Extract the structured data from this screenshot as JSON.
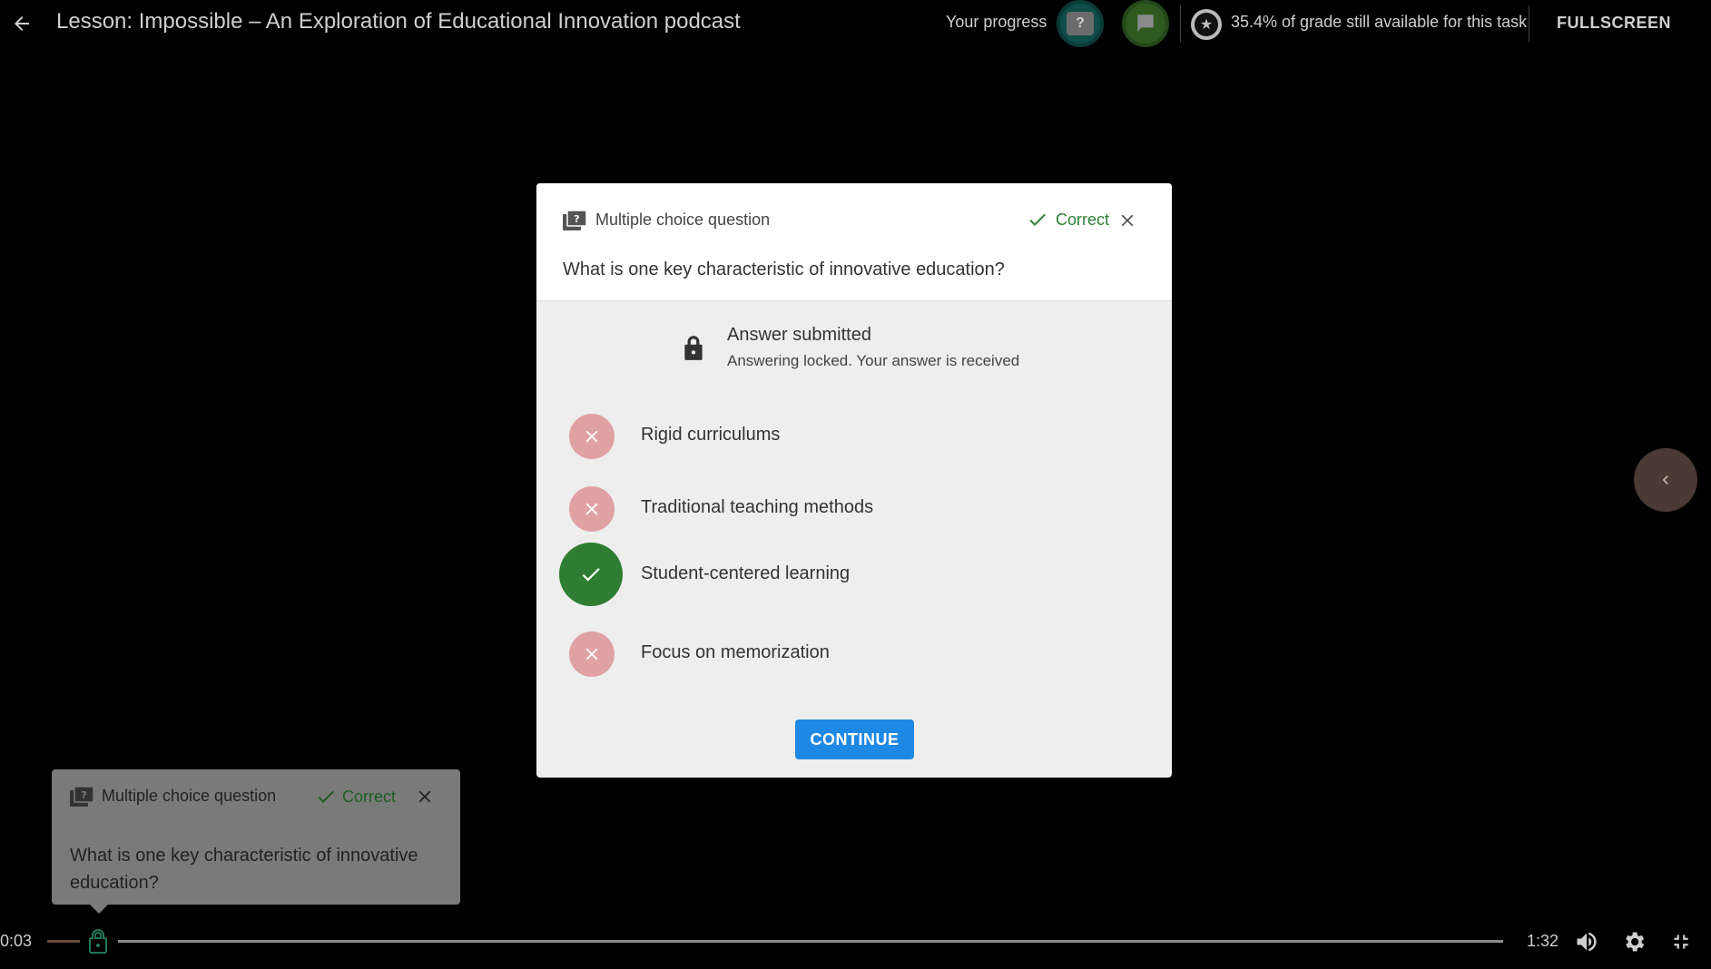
{
  "header": {
    "title": "Lesson: Impossible – An Exploration of Educational Innovation podcast",
    "progress_label": "Your progress",
    "progress_question_glyph": "?",
    "grade_text": "35.4% of grade still available for this task",
    "fullscreen_label": "FULLSCREEN"
  },
  "modal": {
    "type_label": "Multiple choice question",
    "status_label": "Correct",
    "question": "What is one key characteristic of innovative education?",
    "submitted_title": "Answer submitted",
    "submitted_note": "Answering locked. Your answer is received",
    "options": [
      {
        "label": "Rigid curriculums",
        "state": "incorrect"
      },
      {
        "label": "Traditional teaching methods",
        "state": "incorrect"
      },
      {
        "label": "Student-centered learning",
        "state": "correct"
      },
      {
        "label": "Focus on memorization",
        "state": "incorrect"
      }
    ],
    "continue_label": "CONTINUE"
  },
  "mini_card": {
    "type_label": "Multiple choice question",
    "status_label": "Correct",
    "question": "What is one key characteristic of innovative education?"
  },
  "player": {
    "current_time": "0:03",
    "total_time": "1:32"
  },
  "colors": {
    "correct": "#2e7d32",
    "incorrect": "#e0a1a3",
    "primary_button": "#1e88e5"
  }
}
